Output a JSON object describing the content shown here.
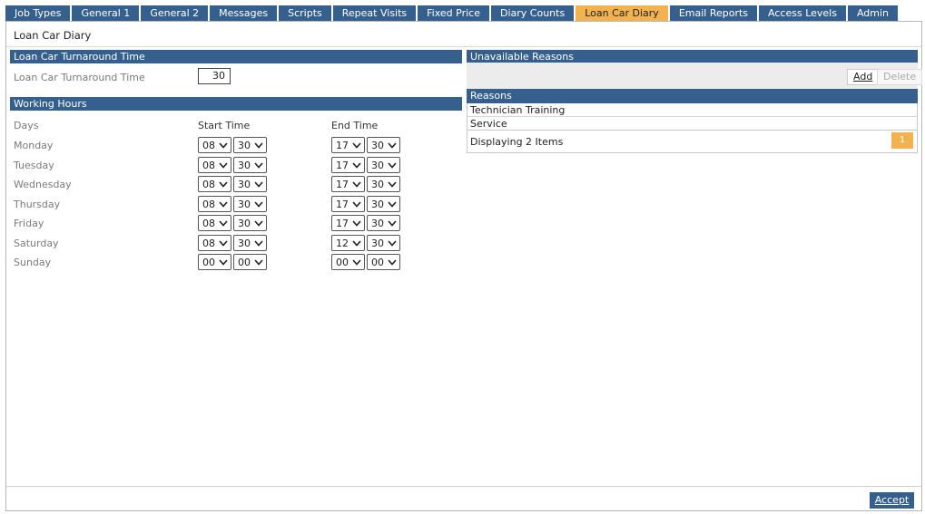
{
  "tabs": [
    {
      "label": "Job Types",
      "active": false
    },
    {
      "label": "General 1",
      "active": false
    },
    {
      "label": "General 2",
      "active": false
    },
    {
      "label": "Messages",
      "active": false
    },
    {
      "label": "Scripts",
      "active": false
    },
    {
      "label": "Repeat Visits",
      "active": false
    },
    {
      "label": "Fixed Price",
      "active": false
    },
    {
      "label": "Diary Counts",
      "active": false
    },
    {
      "label": "Loan Car Diary",
      "active": true
    },
    {
      "label": "Email Reports",
      "active": false
    },
    {
      "label": "Access Levels",
      "active": false
    },
    {
      "label": "Admin",
      "active": false
    }
  ],
  "page": {
    "title": "Loan Car Diary"
  },
  "turnaround": {
    "header": "Loan Car Turnaround Time",
    "label": "Loan Car Turnaround Time",
    "value": "30"
  },
  "working_hours": {
    "header": "Working Hours",
    "col_days": "Days",
    "col_start": "Start Time",
    "col_end": "End Time",
    "days": [
      {
        "day": "Monday",
        "start_h": "08",
        "start_m": "30",
        "end_h": "17",
        "end_m": "30"
      },
      {
        "day": "Tuesday",
        "start_h": "08",
        "start_m": "30",
        "end_h": "17",
        "end_m": "30"
      },
      {
        "day": "Wednesday",
        "start_h": "08",
        "start_m": "30",
        "end_h": "17",
        "end_m": "30"
      },
      {
        "day": "Thursday",
        "start_h": "08",
        "start_m": "30",
        "end_h": "17",
        "end_m": "30"
      },
      {
        "day": "Friday",
        "start_h": "08",
        "start_m": "30",
        "end_h": "17",
        "end_m": "30"
      },
      {
        "day": "Saturday",
        "start_h": "08",
        "start_m": "30",
        "end_h": "12",
        "end_m": "30"
      },
      {
        "day": "Sunday",
        "start_h": "00",
        "start_m": "00",
        "end_h": "00",
        "end_m": "00"
      }
    ]
  },
  "unavailable": {
    "header": "Unavailable Reasons",
    "add_label": "Add",
    "delete_label": "Delete",
    "grid_header": "Reasons",
    "reasons": [
      "Technician Training",
      "Service"
    ],
    "pager_text": "Displaying 2 Items",
    "page": "1"
  },
  "footer": {
    "accept_label": "Accept"
  },
  "colors": {
    "header_blue": "#35608e",
    "active_tab": "#f2b250"
  }
}
